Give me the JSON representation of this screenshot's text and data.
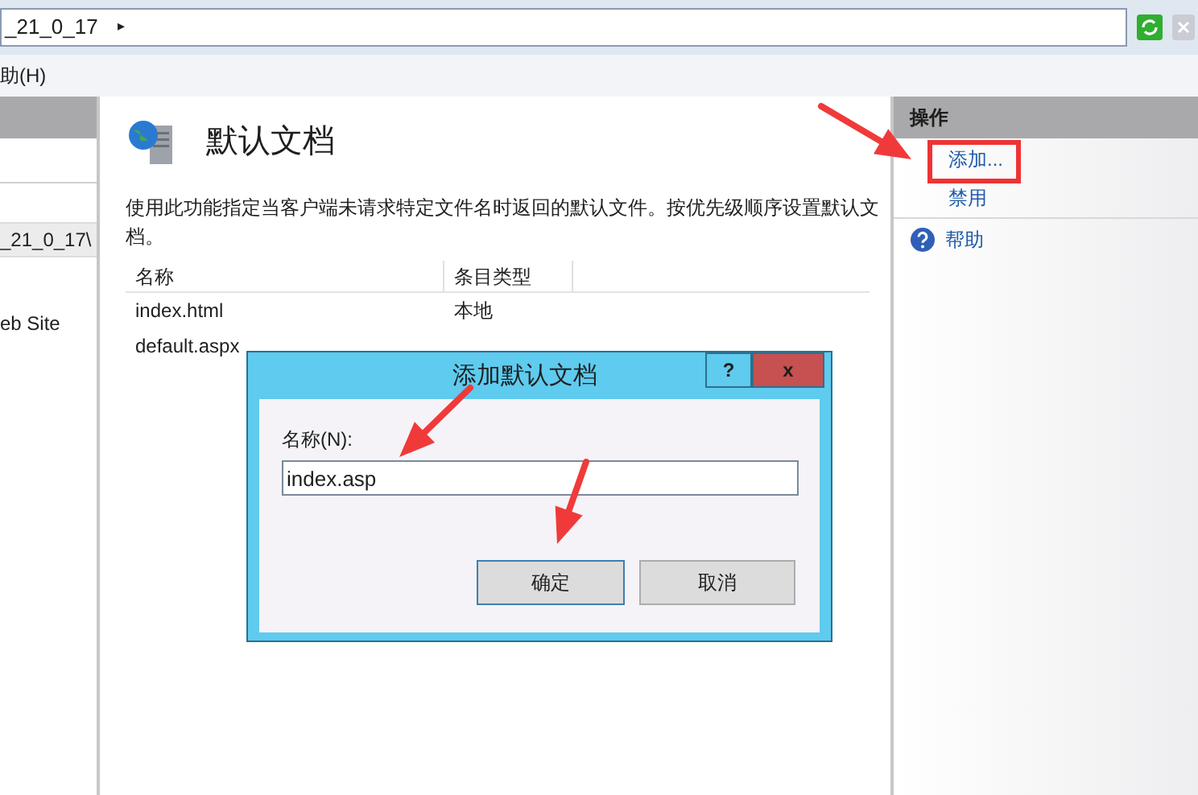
{
  "address_bar": {
    "path": "_21_0_17",
    "separator": "▸"
  },
  "menu_bar": {
    "items": [
      "助(H)"
    ]
  },
  "left_tree": {
    "items": [
      {
        "label": "_21_0_17\\",
        "selected": true
      },
      {
        "label": "eb Site",
        "selected": false
      }
    ]
  },
  "feature": {
    "title": "默认文档",
    "description": "使用此功能指定当客户端未请求特定文件名时返回的默认文件。按优先级顺序设置默认文档。",
    "table": {
      "columns": [
        "名称",
        "条目类型"
      ],
      "rows": [
        [
          "index.html",
          "本地"
        ],
        [
          "default.aspx"
        ]
      ]
    }
  },
  "actions": {
    "title": "操作",
    "items": [
      {
        "label": "添加...",
        "kind": "link",
        "highlighted": true
      },
      {
        "label": "禁用",
        "kind": "link",
        "highlighted": false
      },
      {
        "label": "帮助",
        "kind": "help",
        "highlighted": false
      }
    ]
  },
  "dialog": {
    "title": "添加默认文档",
    "help": "?",
    "close": "x",
    "field_label": "名称(N):",
    "field_value": "index.asp",
    "buttons": [
      {
        "label": "确定",
        "selected": true
      },
      {
        "label": "取消",
        "selected": false
      }
    ]
  }
}
